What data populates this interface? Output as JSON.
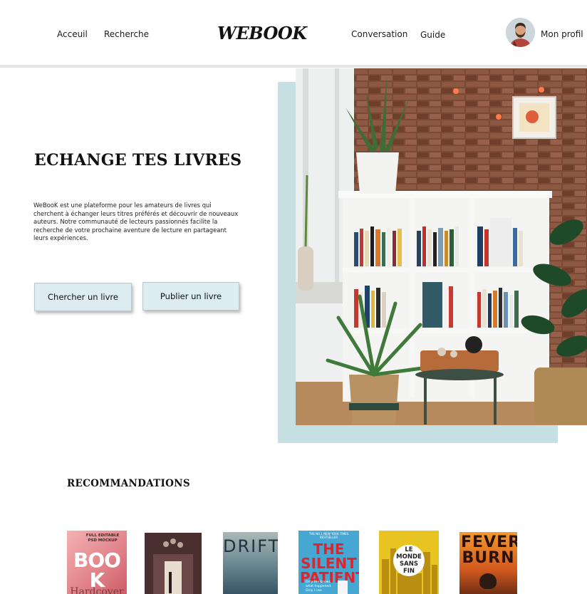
{
  "header": {
    "nav_left": [
      "Acceuil",
      "Recherche"
    ],
    "logo": "WEBOOK",
    "nav_right": [
      "Conversation",
      "Guide"
    ],
    "profile_label": "Mon profil"
  },
  "hero": {
    "title": "ECHANGE TES LIVRES",
    "description": "WeBooK est une plateforme pour les amateurs de livres qui cherchent à échanger leurs titres préférés et découvrir de nouveaux auteurs. Notre communauté de lecteurs passionnés facilite la recherche de votre prochaine aventure de lecture en partageant leurs expériences.",
    "btn_search": "Chercher un livre",
    "btn_publish": "Publier un livre"
  },
  "recommendations": {
    "title": "RECOMMANDATIONS",
    "books": [
      {
        "top_text": "FULL EDITABLE PSD MOCKUP",
        "title": "BOOK",
        "subtitle": "Hardcover",
        "color": "#e07f86"
      },
      {
        "top_text": "",
        "title": "",
        "subtitle": "",
        "color": "#4a3030"
      },
      {
        "top_text": "",
        "title": "DRIFT",
        "subtitle": "",
        "color": "#6f8a93"
      },
      {
        "top_text": "THE NO.1 NEW YORK TIMES BESTSELLER",
        "title": "THE SILENT PATIENT",
        "subtitle": "Only the knows what happened. Only I can",
        "color": "#46a7d2"
      },
      {
        "top_text": "",
        "title": "LE MONDE SANS FIN",
        "subtitle": "",
        "color": "#e6c21f"
      },
      {
        "top_text": "",
        "title": "FEVER BURN",
        "subtitle": "",
        "color": "#d35a1f"
      }
    ]
  },
  "colors": {
    "accent_light": "#c6dfe3",
    "button_bg": "#dcecf0"
  }
}
